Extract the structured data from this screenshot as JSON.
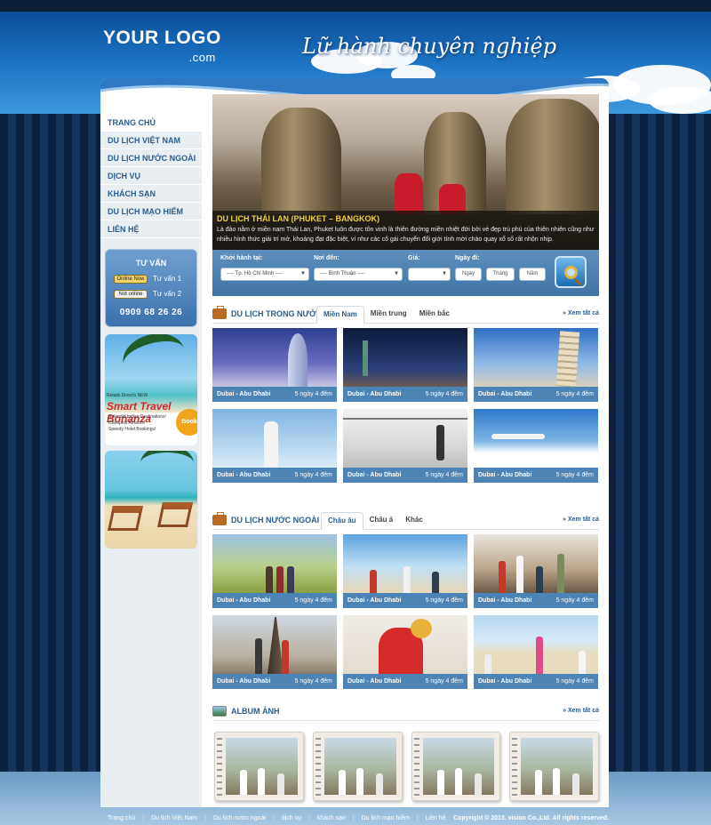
{
  "header": {
    "logo_main": "YOUR LOGO",
    "logo_sub": ".com",
    "slogan": "Lữ hành chuyên nghiệp"
  },
  "menu": [
    {
      "label": "Trang chủ"
    },
    {
      "label": "Du lịch Việt Nam"
    },
    {
      "label": "Du lịch nước ngoài"
    },
    {
      "label": "Dịch vụ"
    },
    {
      "label": "Khách sạn"
    },
    {
      "label": "Du lịch mạo hiểm"
    },
    {
      "label": "Liên hệ"
    }
  ],
  "consult": {
    "title": "TƯ VẤN",
    "items": [
      {
        "status": "Online Now",
        "label": "Tư vấn 1"
      },
      {
        "status": "Not online",
        "label": "Tư vấn 2"
      }
    ],
    "phone": "0909 68 26 26"
  },
  "ad": {
    "small": "Retails Direct's NEW",
    "title": "Smart Travel Bonanza",
    "lines": [
      "Splendid Indian Destinations!",
      "Cheapest Airfares!",
      "Speedy Hotel Bookings!"
    ],
    "badge": "Book Now"
  },
  "hero": {
    "title": "DU LỊCH THÁI LAN (PHUKET – BANGKOK)",
    "desc": "Là đảo nằm ở miền nam Thái Lan, Phuket luôn được tôn vinh là thiên đường miền nhiệt đới bởi vẻ đẹp trù phú của thiên nhiên cũng như nhiều hình thức giải trí mở, khoảng đạt đặc biệt, ví như các cô gái chuyển đổi giới tính mời chào quay xổ số rất nhộn nhịp."
  },
  "search": {
    "from_label": "Khởi hành tại:",
    "from_value": "---- Tp. Hồ Chí Minh ----",
    "to_label": "Nơi đến:",
    "to_value": "---- Bình Thuận ----",
    "price_label": "Giá:",
    "date_label": "Ngày đi:",
    "day_placeholder": "Ngày",
    "month_placeholder": "Tháng",
    "year_placeholder": "Năm"
  },
  "domestic": {
    "title": "DU LỊCH TRONG NƯỚC",
    "tabs": [
      "Miền Nam",
      "Miền trung",
      "Miền bắc"
    ],
    "more": "» Xem tất cả",
    "cards": [
      {
        "name": "Dubai - Abu Dhabi",
        "duration": "5 ngày 4 đêm"
      },
      {
        "name": "Dubai - Abu Dhabi",
        "duration": "5 ngày 4 đêm"
      },
      {
        "name": "Dubai - Abu Dhabi",
        "duration": "5 ngày 4 đêm"
      },
      {
        "name": "Dubai - Abu Dhabi",
        "duration": "5 ngày 4 đêm"
      },
      {
        "name": "Dubai - Abu Dhabi",
        "duration": "5 ngày 4 đêm"
      },
      {
        "name": "Dubai - Abu Dhabi",
        "duration": "5 ngày 4 đêm"
      }
    ]
  },
  "foreign": {
    "title": "DU LỊCH NƯỚC NGOÀI",
    "tabs": [
      "Châu âu",
      "Châu á",
      "Khác"
    ],
    "more": "» Xem tất cả",
    "cards": [
      {
        "name": "Dubai - Abu Dhabi",
        "duration": "5 ngày 4 đêm"
      },
      {
        "name": "Dubai - Abu Dhabi",
        "duration": "5 ngày 4 đêm"
      },
      {
        "name": "Dubai - Abu Dhabi",
        "duration": "5 ngày 4 đêm"
      },
      {
        "name": "Dubai - Abu Dhabi",
        "duration": "5 ngày 4 đêm"
      },
      {
        "name": "Dubai - Abu Dhabi",
        "duration": "5 ngày 4 đêm"
      },
      {
        "name": "Dubai - Abu Dhabi",
        "duration": "5 ngày 4 đêm"
      }
    ]
  },
  "album": {
    "title": "ALBUM ẢNH",
    "more": "» Xem tất cả"
  },
  "footer": {
    "links": [
      "Trang chủ",
      "Du lịch Việt Nam",
      "Du lịch nước ngoài",
      "dịch vụ",
      "khách sạn",
      "Du lịch mạo hiểm",
      "Liên hệ"
    ],
    "copyright": "Copyright © 2013. vision Co.,Ltd. All rights reserved."
  },
  "colors": {
    "accent": "#2a5d8f",
    "caption_bar": "#4b84b5",
    "hero_title": "#f0d23c"
  }
}
